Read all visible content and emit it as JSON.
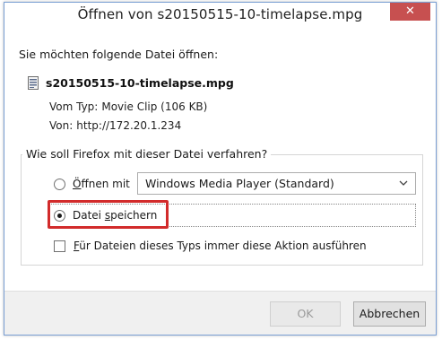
{
  "dialog": {
    "title": "Öffnen von s20150515-10-timelapse.mpg",
    "close_symbol": "✕"
  },
  "content": {
    "question": "Sie möchten folgende Datei öffnen:",
    "file_icon": "document-icon",
    "file_name": "s20150515-10-timelapse.mpg",
    "type_label": "Vom Typ:",
    "type_value": "Movie Clip (106 KB)",
    "from_label": "Von:",
    "from_value": "http://172.20.1.234"
  },
  "action_group": {
    "legend": "Wie soll Firefox mit dieser Datei verfahren?",
    "open_with_prefix": "Ö",
    "open_with_rest": "ffnen mit",
    "open_with_selected": false,
    "open_with_app": "Windows Media Player (Standard)",
    "save_prefix": "Datei ",
    "save_underlined": "s",
    "save_rest": "peichern",
    "save_selected": true,
    "always_prefix": "F",
    "always_rest": "ür Dateien dieses Typs immer diese Aktion ausführen",
    "always_checked": false
  },
  "footer": {
    "ok_label": "OK",
    "cancel_label": "Abbrechen"
  },
  "colors": {
    "close_button": "#c75050",
    "highlight_box": "#d22b2b"
  }
}
